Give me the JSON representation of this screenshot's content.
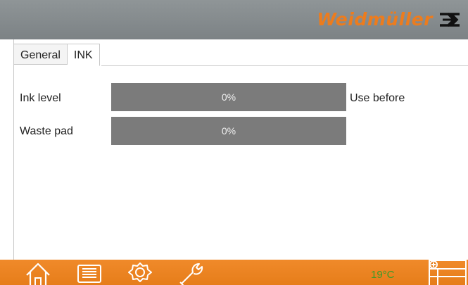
{
  "brand": {
    "name": "Weidmüller",
    "color": "#ec7c1e"
  },
  "tabs": [
    {
      "label": "General",
      "active": false
    },
    {
      "label": "INK",
      "active": true
    }
  ],
  "ink": {
    "ink_level": {
      "label": "Ink level",
      "value_text": "0%",
      "percent": 0
    },
    "waste_pad": {
      "label": "Waste pad",
      "value_text": "0%",
      "percent": 0
    },
    "use_before_label": "Use before"
  },
  "footer": {
    "icons": [
      "home-icon",
      "printer-icon",
      "settings-icon",
      "tools-icon",
      "layout-icon"
    ],
    "temperature": "19°C"
  }
}
